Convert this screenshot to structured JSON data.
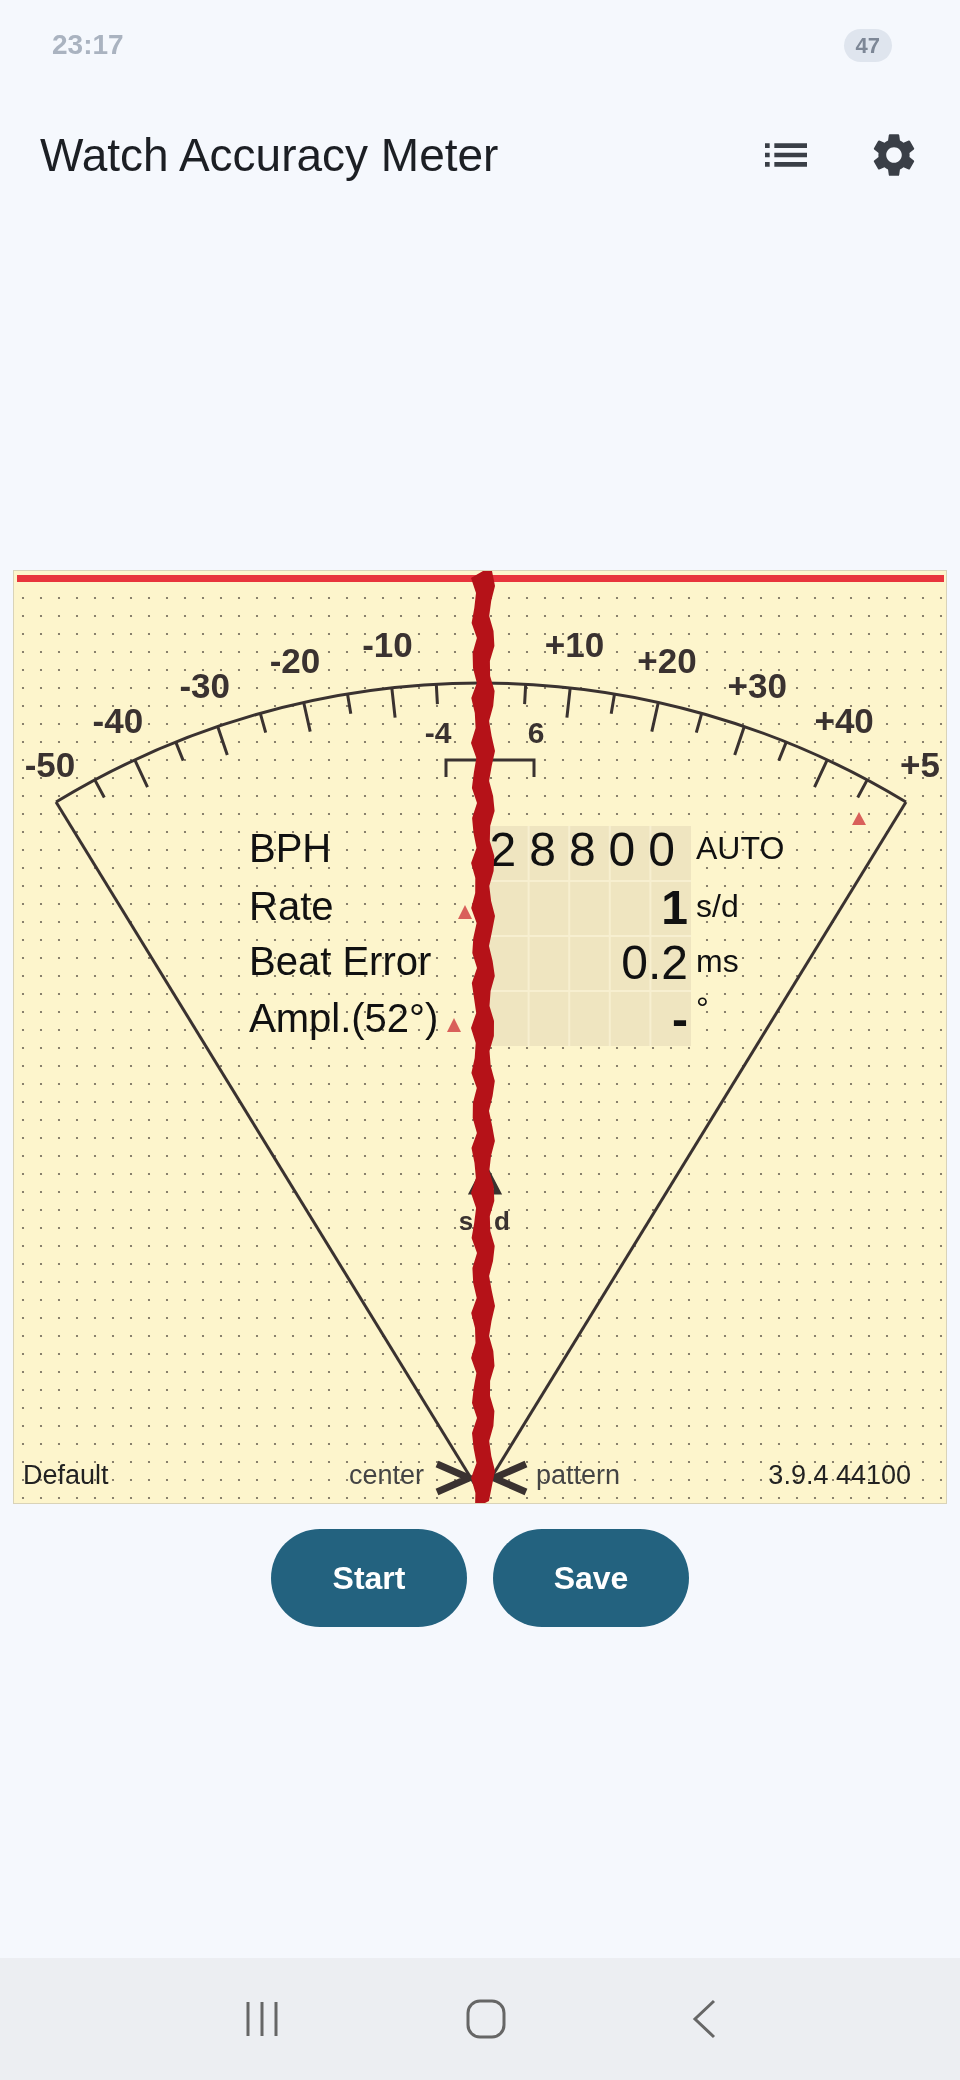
{
  "status_bar": {
    "time": "23:17",
    "battery": "47"
  },
  "app_bar": {
    "title": "Watch Accuracy Meter"
  },
  "dial": {
    "scale_labels": [
      "-50",
      "-40",
      "-30",
      "-20",
      "-10",
      "+10",
      "+20",
      "+30",
      "+40",
      "+5"
    ],
    "inner_labels": [
      "-4",
      "6"
    ],
    "readings": [
      {
        "label": "BPH",
        "value": "28800",
        "unit": "AUTO"
      },
      {
        "label": "Rate",
        "value": "1",
        "unit": "s/d"
      },
      {
        "label": "Beat Error",
        "value": "0.2",
        "unit": "ms"
      },
      {
        "label": "Ampl.(52°)",
        "value": "-",
        "unit": "°"
      }
    ],
    "marker_unit": [
      "s",
      "d"
    ],
    "footer": {
      "profile": "Default",
      "center": "center",
      "pattern": "pattern",
      "version": "3.9.4 44100"
    }
  },
  "buttons": [
    "Start",
    "Save"
  ]
}
